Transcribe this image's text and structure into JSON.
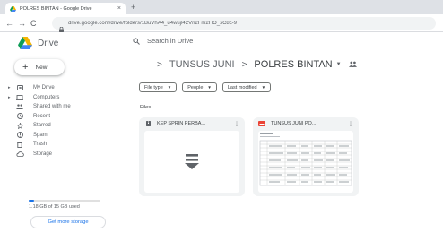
{
  "browser": {
    "tab_title": "POLRES BINTAN - Google Drive",
    "new_tab": "+",
    "url": "drive.google.com/drive/folders/1BuVhA4_u4wujl42Vn2Fm2HO_sC8c-9"
  },
  "drive": {
    "logo_text": "Drive",
    "search_placeholder": "Search in Drive",
    "new_button": "New",
    "nav": [
      {
        "label": "My Drive",
        "icon": "my-drive-icon"
      },
      {
        "label": "Computers",
        "icon": "computer-icon"
      },
      {
        "label": "Shared with me",
        "icon": "shared-icon"
      },
      {
        "label": "Recent",
        "icon": "clock-icon"
      },
      {
        "label": "Starred",
        "icon": "star-icon"
      },
      {
        "label": "Spam",
        "icon": "spam-icon"
      },
      {
        "label": "Trash",
        "icon": "trash-icon"
      },
      {
        "label": "Storage",
        "icon": "cloud-icon"
      }
    ],
    "storage_used_fraction": 0.079,
    "storage_text": "1.18 GB of 15 GB used",
    "get_storage": "Get more storage",
    "breadcrumb": {
      "more": "···",
      "separator": ">",
      "parent": "TUNSUS JUNI",
      "current": "POLRES BINTAN"
    },
    "filters": [
      "File type",
      "People",
      "Last modified"
    ],
    "files_heading": "Files",
    "files": [
      {
        "name": "KEP SPRIN PERBA...",
        "type": "zip-icon"
      },
      {
        "name": "TUNSUS JUNI PO...",
        "type": "pdf-icon"
      }
    ],
    "colors": {
      "accent": "#1a73e8",
      "pdf": "#ea4335",
      "logo_green": "#0f9d58",
      "logo_yellow": "#f4b400",
      "logo_blue": "#4285f4"
    }
  }
}
